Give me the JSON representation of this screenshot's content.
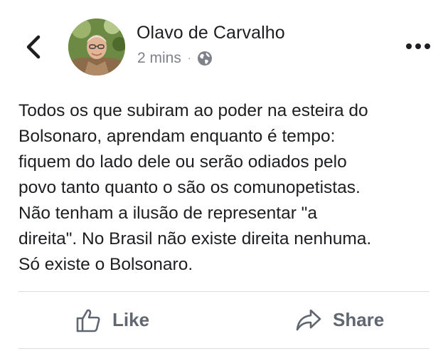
{
  "post": {
    "author": "Olavo de Carvalho",
    "timestamp": "2 mins",
    "separator": "·",
    "privacy_icon": "globe-icon",
    "lines": [
      "Todos os que subiram ao poder na esteira do",
      "Bolsonaro, aprendam enquanto é tempo:",
      "fiquem do lado dele ou serão odiados pelo",
      "povo tanto quanto o são os comunopetistas.",
      "Não tenham a ilusão de representar \"a",
      "direita\". No Brasil não existe direita nenhuma.",
      "Só existe o Bolsonaro."
    ]
  },
  "header": {
    "back_icon": "chevron-left-icon",
    "more_icon": "more-dots-icon"
  },
  "actions": {
    "like_label": "Like",
    "like_icon": "thumbs-up-icon",
    "share_label": "Share",
    "share_icon": "share-arrow-icon"
  },
  "colors": {
    "text": "#1c1e21",
    "meta": "#7f8289",
    "action": "#606770",
    "divider": "#dadde1"
  }
}
